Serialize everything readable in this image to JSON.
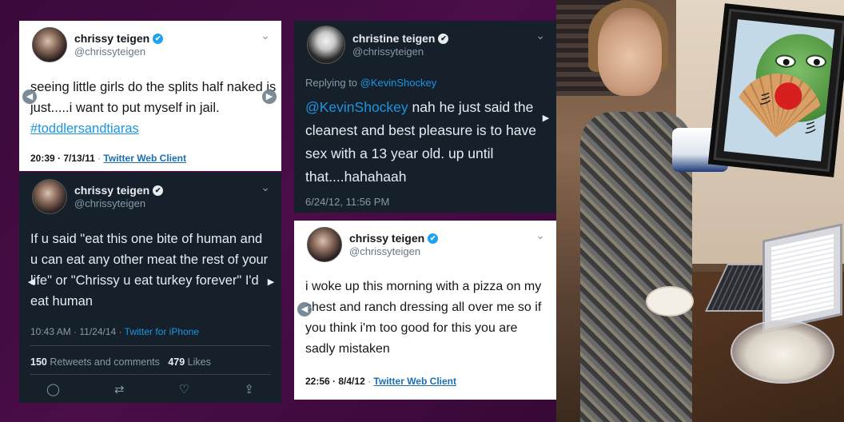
{
  "tweets": [
    {
      "display_name": "chrissy teigen",
      "handle": "@chrissyteigen",
      "text": "seeing little girls do the splits half naked is just.....i want to put myself in jail. ",
      "hashtag": "#toddlersandtiaras",
      "time": "20:39",
      "date": "7/13/11",
      "client": "Twitter Web Client"
    },
    {
      "display_name": "chrissy teigen",
      "handle": "@chrissyteigen",
      "text": "If u said \"eat this one bite of human and u can eat any other meat the rest of your life\" or \"Chrissy u eat turkey forever\" I'd eat human",
      "time": "10:43 AM",
      "date": "11/24/14",
      "client": "Twitter for iPhone",
      "retweets": "150",
      "retweets_label": "Retweets and comments",
      "likes": "479",
      "likes_label": "Likes"
    },
    {
      "display_name": "christine teigen",
      "handle": "@chrissyteigen",
      "replying_label": "Replying to",
      "replying_to": "@KevinShockey",
      "mention": "@KevinShockey",
      "text": " nah he just said the cleanest and best pleasure is to have sex with a 13 year old. up until that....hahahaah",
      "datetime": "6/24/12, 11:56 PM"
    },
    {
      "display_name": "chrissy teigen",
      "handle": "@chrissyteigen",
      "text": "i woke up this morning with a pizza on my chest and ranch dressing all over me so if you think i'm too good for this you are sadly mistaken",
      "time": "22:56",
      "date": "8/4/12",
      "client": "Twitter Web Client"
    }
  ],
  "separator": " · ",
  "icons": {
    "verified": "✔",
    "chevron": "⌄",
    "arrow_left": "◀",
    "arrow_right": "▶",
    "reply": "◯",
    "retweet": "⇄",
    "like": "♡",
    "share": "⇪"
  },
  "colors": {
    "background": "#3a0a3a",
    "tweet_dark": "#15202b",
    "tweet_light": "#ffffff",
    "link": "#1b95e0"
  }
}
